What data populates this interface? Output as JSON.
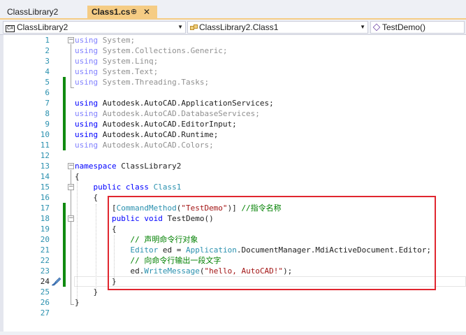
{
  "tabs": {
    "inactive": "ClassLibrary2",
    "active": "Class1.cs",
    "pin": "⊕",
    "close": "✕"
  },
  "nav": {
    "project": "ClassLibrary2",
    "type": "ClassLibrary2.Class1",
    "member": "TestDemo()"
  },
  "code": {
    "l1_kw": "using",
    "l1_rest": " System;",
    "l2_kw": "using",
    "l2_rest": " System.Collections.Generic;",
    "l3_kw": "using",
    "l3_rest": " System.Linq;",
    "l4_kw": "using",
    "l4_rest": " System.Text;",
    "l5_kw": "using",
    "l5_rest": " System.Threading.Tasks;",
    "l7_kw": "using",
    "l7_rest": " Autodesk.AutoCAD.ApplicationServices;",
    "l8_kw": "using",
    "l8_rest": " Autodesk.AutoCAD.DatabaseServices;",
    "l9_kw": "using",
    "l9_rest": " Autodesk.AutoCAD.EditorInput;",
    "l10_kw": "using",
    "l10_rest": " Autodesk.AutoCAD.Runtime;",
    "l11_kw": "using",
    "l11_rest": " Autodesk.AutoCAD.Colors;",
    "l13_kw": "namespace",
    "l13_rest": " ClassLibrary2",
    "l14": "{",
    "l15_kw1": "public",
    "l15_kw2": " class",
    "l15_type": " Class1",
    "l16": "{",
    "l17_open": "[",
    "l17_attr": "CommandMethod",
    "l17_p": "(",
    "l17_str": "\"TestDemo\"",
    "l17_close": ")] ",
    "l17_cm": "//指令名称",
    "l18_kw1": "public",
    "l18_kw2": " void",
    "l18_rest": " TestDemo()",
    "l19": "{",
    "l20_cm": "// 声明命令行对象",
    "l21_t1": "Editor",
    "l21_a": " ed = ",
    "l21_t2": "Application",
    "l21_b": ".DocumentManager.MdiActiveDocument.Editor;",
    "l22_cm": "// 向命令行输出一段文字",
    "l23_a": "ed.",
    "l23_m": "WriteMessage",
    "l23_p": "(",
    "l23_str": "\"hello, AutoCAD!\"",
    "l23_b": ");",
    "l24": "}",
    "l25": "}",
    "l26": "}"
  },
  "line_numbers": [
    "1",
    "2",
    "3",
    "4",
    "5",
    "6",
    "7",
    "8",
    "9",
    "10",
    "11",
    "12",
    "13",
    "14",
    "15",
    "16",
    "17",
    "18",
    "19",
    "20",
    "21",
    "22",
    "23",
    "24",
    "25",
    "26",
    "27"
  ],
  "colors": {
    "keyword": "#0000ff",
    "type": "#2b91af",
    "string": "#a31515",
    "comment": "#008000",
    "change_bar": "#108a10",
    "highlight_box": "#e0262f",
    "active_tab": "#f5cc84"
  },
  "icons": {
    "project_icon": "csharp-project-icon",
    "class_icon": "class-icon",
    "member_icon": "method-cube-icon",
    "gutter_icon": "paintbrush-icon"
  }
}
